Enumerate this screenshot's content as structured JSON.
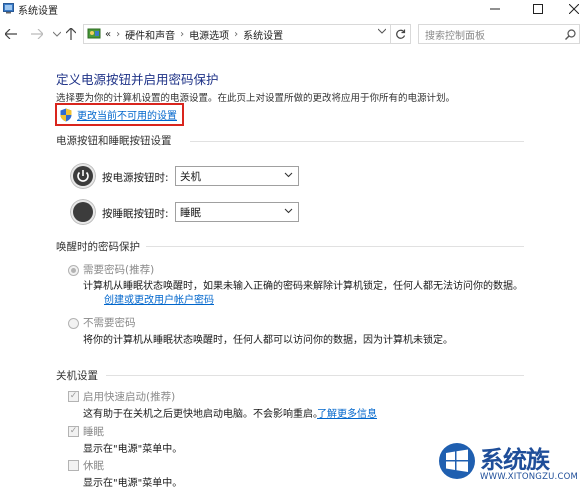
{
  "window": {
    "title": "系统设置",
    "minimize_icon": "minimize-icon",
    "maximize_icon": "maximize-icon",
    "close_icon": "close-icon"
  },
  "addressbar": {
    "overflow": "«",
    "crumbs": [
      "硬件和声音",
      "电源选项",
      "系统设置"
    ],
    "search_placeholder": "搜索控制面板"
  },
  "page": {
    "heading": "定义电源按钮并启用密码保护",
    "description": "选择要为你的计算机设置的电源设置。在此页上对设置所做的更改将应用于你所有的电源计划。",
    "change_link": "更改当前不可用的设置",
    "accent_color": "#1e3287",
    "link_color": "#0066cc",
    "highlight_color": "#d9251d"
  },
  "buttons_section": {
    "title": "电源按钮和睡眠按钮设置",
    "power_label": "按电源按钮时:",
    "power_value": "关机",
    "sleep_label": "按睡眠按钮时:",
    "sleep_value": "睡眠"
  },
  "password_section": {
    "title": "唤醒时的密码保护",
    "require_label": "需要密码(推荐)",
    "require_desc": "计算机从睡眠状态唤醒时，如果未输入正确的密码来解除计算机锁定，任何人都无法访问你的数据。",
    "require_link": "创建或更改用户帐户密码",
    "no_require_label": "不需要密码",
    "no_require_desc": "将你的计算机从睡眠状态唤醒时，任何人都可以访问你的数据，因为计算机未锁定。"
  },
  "shutdown_section": {
    "title": "关机设置",
    "fast_startup_label": "启用快速启动(推荐)",
    "fast_startup_desc": "这有助于在关机之后更快地启动电脑。不会影响重启。",
    "learn_more": "了解更多信息",
    "sleep_label": "睡眠",
    "sleep_desc": "显示在\"电源\"菜单中。",
    "hibernate_label": "休眠",
    "hibernate_desc": "显示在\"电源\"菜单中。"
  },
  "watermark": {
    "brand": "系统族",
    "url": "WWW.XITONGZU.COM"
  }
}
